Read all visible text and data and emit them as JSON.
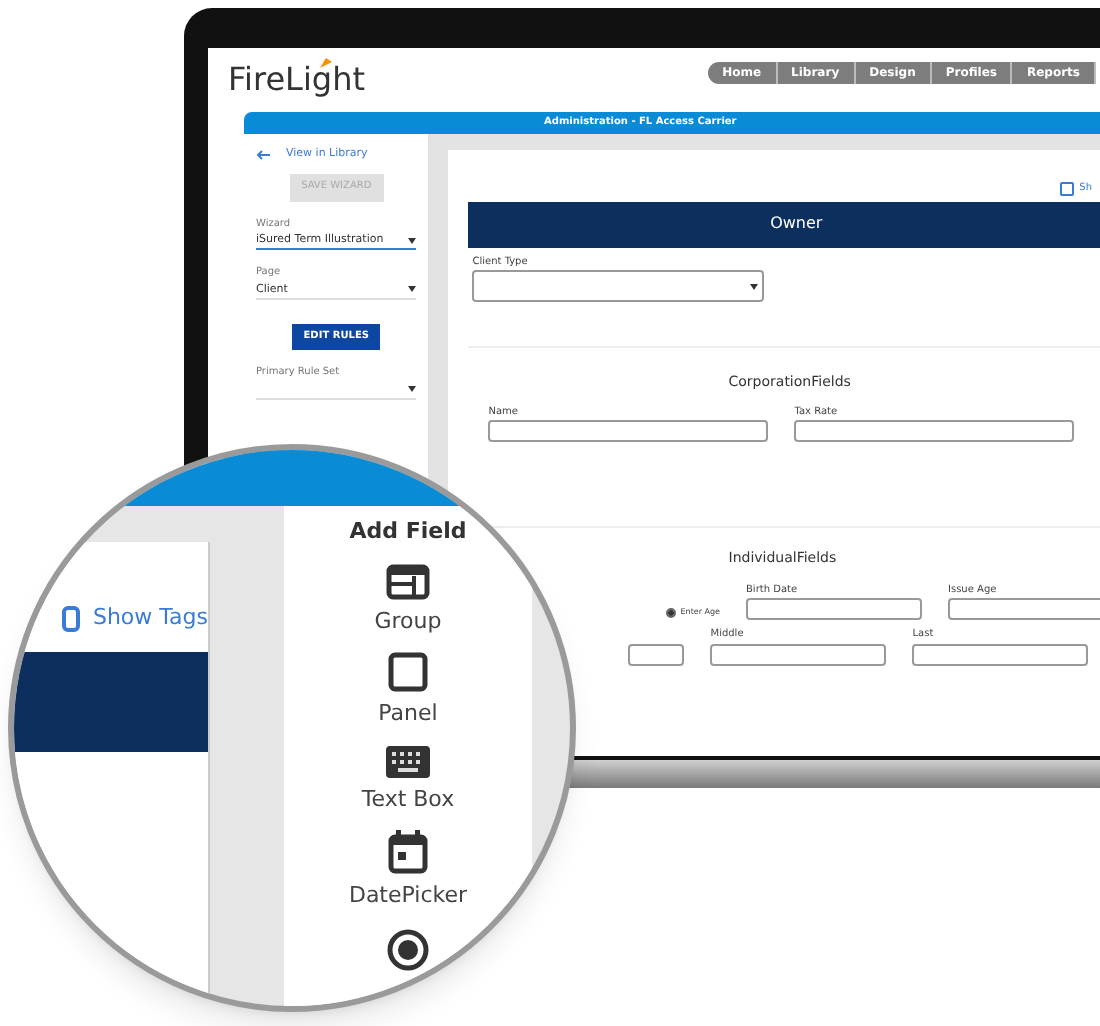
{
  "logo": {
    "text": "FireLight"
  },
  "nav_tabs": [
    {
      "label": "Home"
    },
    {
      "label": "Library"
    },
    {
      "label": "Design"
    },
    {
      "label": "Profiles"
    },
    {
      "label": "Reports"
    }
  ],
  "title_bar": "Administration - FL Access Carrier",
  "sidebar": {
    "back_link": "View in Library",
    "save_button": {
      "label": "SAVE WIZARD",
      "disabled": true
    },
    "items": [
      {
        "kind": "select",
        "label": "Wizard",
        "value": "iSured Term Illustration",
        "active": true
      },
      {
        "kind": "select",
        "label": "Page",
        "value": "Client",
        "active": false
      },
      {
        "kind": "button",
        "label": "EDIT RULES"
      },
      {
        "kind": "select",
        "label": "Primary Rule Set",
        "active": false
      }
    ]
  },
  "form": {
    "show_tags": {
      "label": "Sh",
      "checked": false
    },
    "header": "Owner",
    "client_type": {
      "label": "Client Type"
    },
    "groups": [
      {
        "title": "CorporationFields",
        "rows": [
          [
            {
              "kind": "field",
              "label": "Name"
            },
            {
              "kind": "field",
              "label": "Tax Rate"
            }
          ]
        ]
      },
      {
        "title": "IndividualFields",
        "rows": [
          [
            {
              "kind": "radio",
              "label": "Enter Age",
              "selected": true
            },
            {
              "kind": "field",
              "label": "Birth Date"
            },
            {
              "kind": "field",
              "label": "Issue Age"
            }
          ],
          [
            {
              "kind": "field"
            },
            {
              "kind": "field",
              "label": "Middle"
            },
            {
              "kind": "field",
              "label": "Last"
            }
          ]
        ]
      }
    ]
  },
  "magnifier": {
    "show_tags": {
      "label": "Show Tags",
      "checked": false
    },
    "panel_title": "Add Field",
    "items": [
      {
        "kind": "group",
        "label": "Group"
      },
      {
        "kind": "panel",
        "label": "Panel"
      },
      {
        "kind": "textbox",
        "label": "Text Box"
      },
      {
        "kind": "datepicker",
        "label": "DatePicker"
      },
      {
        "kind": "radio"
      }
    ]
  }
}
